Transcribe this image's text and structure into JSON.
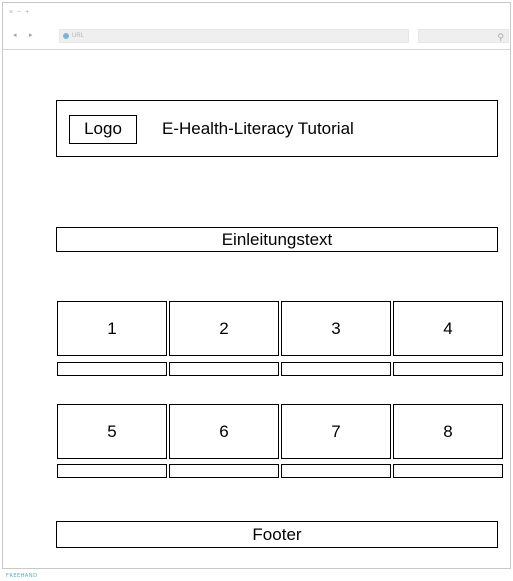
{
  "browser": {
    "window_controls": "× − +",
    "back_symbol": "◂",
    "forward_symbol": "▸",
    "url_placeholder": "URL",
    "search_symbol": "⚲"
  },
  "header": {
    "logo_label": "Logo",
    "title": "E-Health-Literacy Tutorial"
  },
  "intro": {
    "label": "Einleitungstext"
  },
  "tiles_row1": [
    "1",
    "2",
    "3",
    "4"
  ],
  "tiles_row2": [
    "5",
    "6",
    "7",
    "8"
  ],
  "footer": {
    "label": "Footer"
  },
  "brand": "FREEHAND"
}
